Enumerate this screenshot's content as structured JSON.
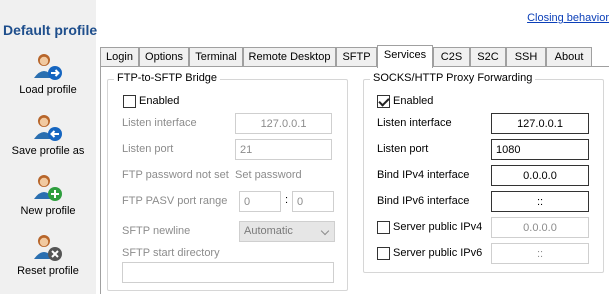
{
  "header": {
    "profile_title": "Default profile",
    "closing_link": "Closing behavior"
  },
  "sidebar": {
    "items": [
      {
        "label": "Load profile",
        "icon": "user-load-icon"
      },
      {
        "label": "Save profile as",
        "icon": "user-save-icon"
      },
      {
        "label": "New profile",
        "icon": "user-new-icon"
      },
      {
        "label": "Reset profile",
        "icon": "user-reset-icon"
      }
    ]
  },
  "tabs": [
    {
      "label": "Login"
    },
    {
      "label": "Options"
    },
    {
      "label": "Terminal"
    },
    {
      "label": "Remote Desktop"
    },
    {
      "label": "SFTP"
    },
    {
      "label": "Services",
      "active": true
    },
    {
      "label": "C2S"
    },
    {
      "label": "S2C"
    },
    {
      "label": "SSH"
    },
    {
      "label": "About"
    }
  ],
  "ftp": {
    "title": "FTP-to-SFTP Bridge",
    "enabled_label": "Enabled",
    "enabled": false,
    "listen_interface_label": "Listen interface",
    "listen_interface": "127.0.0.1",
    "listen_port_label": "Listen port",
    "listen_port": "21",
    "password_label": "FTP password not set",
    "set_password": "Set password",
    "pasv_label": "FTP PASV port range",
    "pasv_from": "0",
    "pasv_sep": ":",
    "pasv_to": "0",
    "newline_label": "SFTP newline",
    "newline_value": "Automatic",
    "start_dir_label": "SFTP start directory",
    "start_dir": ""
  },
  "socks": {
    "title": "SOCKS/HTTP Proxy Forwarding",
    "enabled_label": "Enabled",
    "enabled": true,
    "listen_interface_label": "Listen interface",
    "listen_interface": "127.0.0.1",
    "listen_port_label": "Listen port",
    "listen_port": "1080",
    "bind_ipv4_label": "Bind IPv4 interface",
    "bind_ipv4": "0.0.0.0",
    "bind_ipv6_label": "Bind IPv6 interface",
    "bind_ipv6": "::",
    "server_ipv4_label": "Server public IPv4",
    "server_ipv4": "0.0.0.0",
    "server_ipv6_label": "Server public IPv6",
    "server_ipv6": "::"
  },
  "colors": {
    "title_blue": "#1e4e8c",
    "link_blue": "#0b3fb8",
    "panel_gray": "#f0f0f0"
  }
}
